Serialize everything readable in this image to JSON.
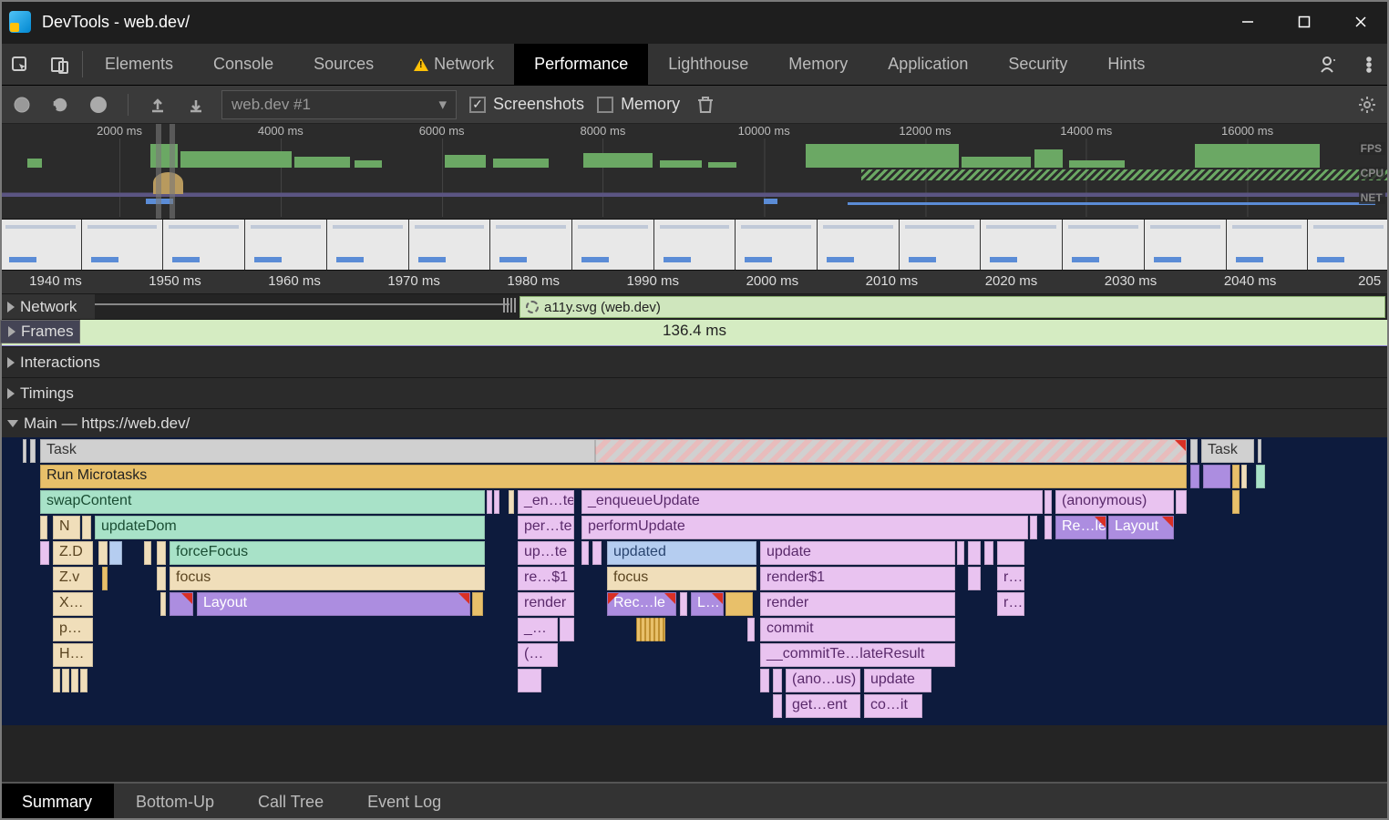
{
  "window": {
    "title": "DevTools - web.dev/"
  },
  "tabs": {
    "items": [
      "Elements",
      "Console",
      "Sources",
      "Network",
      "Performance",
      "Lighthouse",
      "Memory",
      "Application",
      "Security",
      "Hints"
    ],
    "active": "Performance",
    "warning_on": "Network"
  },
  "toolbar": {
    "session": "web.dev #1",
    "screenshots": {
      "label": "Screenshots",
      "checked": true
    },
    "memory": {
      "label": "Memory",
      "checked": false
    }
  },
  "overview": {
    "ticks": [
      "2000 ms",
      "4000 ms",
      "6000 ms",
      "8000 ms",
      "10000 ms",
      "12000 ms",
      "14000 ms",
      "16000 ms"
    ],
    "labels": {
      "fps": "FPS",
      "cpu": "CPU",
      "net": "NET"
    }
  },
  "detail_ruler": [
    "1940 ms",
    "1950 ms",
    "1960 ms",
    "1970 ms",
    "1980 ms",
    "1990 ms",
    "2000 ms",
    "2010 ms",
    "2020 ms",
    "2030 ms",
    "2040 ms",
    "205"
  ],
  "tracks": {
    "network": {
      "label": "Network",
      "item": "a11y.svg (web.dev)"
    },
    "frames": {
      "label": "Frames",
      "duration": "136.4 ms"
    },
    "interactions": "Interactions",
    "timings": "Timings",
    "main": "Main — https://web.dev/"
  },
  "flame": {
    "r0": {
      "task": "Task",
      "task2": "Task"
    },
    "r1": {
      "microtasks": "Run Microtasks"
    },
    "r2": {
      "swap": "swapContent",
      "en": "_en…te",
      "enqueue": "_enqueueUpdate",
      "anon": "(anonymous)"
    },
    "r3": {
      "n": "N",
      "updateDom": "updateDom",
      "per": "per…te",
      "performUpdate": "performUpdate",
      "re": "Re…le",
      "layout": "Layout"
    },
    "r4": {
      "zd": "Z.D",
      "forceFocus": "forceFocus",
      "up": "up…te",
      "updated": "updated",
      "update": "update"
    },
    "r5": {
      "zv": "Z.v",
      "focus": "focus",
      "re1": "re…$1",
      "focus2": "focus",
      "render1": "render$1",
      "r": "r…"
    },
    "r6": {
      "x": "X…",
      "layout": "Layout",
      "render": "render",
      "rec": "Rec…le",
      "l": "L…",
      "render2": "render",
      "r": "r…"
    },
    "r7": {
      "p": "p…",
      "dash": "_…",
      "commit": "commit"
    },
    "r8": {
      "h": "H…",
      "paren": "(…",
      "commitTemplate": "__commitTe…lateResult"
    },
    "r9": {
      "anon": "(ano…us)",
      "update": "update"
    },
    "r10": {
      "get": "get…ent",
      "co": "co…it"
    }
  },
  "bottom_tabs": {
    "items": [
      "Summary",
      "Bottom-Up",
      "Call Tree",
      "Event Log"
    ],
    "active": "Summary"
  }
}
